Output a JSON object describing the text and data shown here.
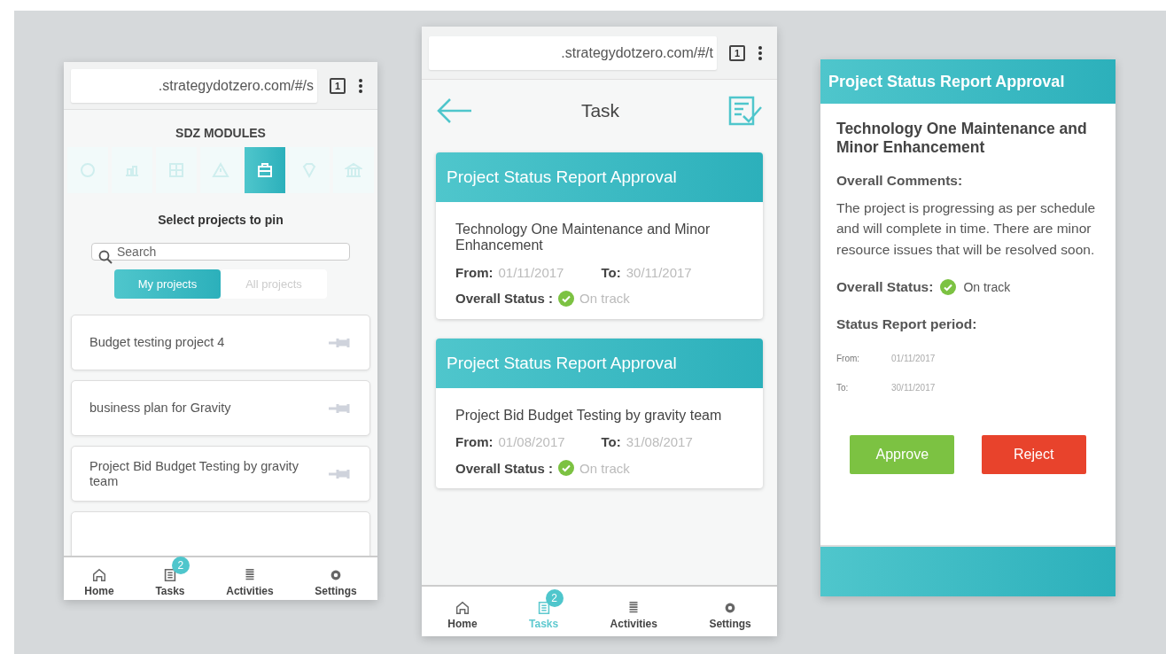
{
  "pin_screen": {
    "browser": {
      "url": ".strategydotzero.com/#/s",
      "tab_count": "1"
    },
    "modules_title": "SDZ MODULES",
    "modules": [
      {
        "selected": false
      },
      {
        "selected": false
      },
      {
        "selected": false
      },
      {
        "selected": false
      },
      {
        "selected": true
      },
      {
        "selected": false
      },
      {
        "selected": false
      }
    ],
    "heading": "Select projects to pin",
    "search": {
      "placeholder": "Search"
    },
    "tabs": [
      {
        "label": "My projects",
        "selected": true
      },
      {
        "label": "All projects",
        "selected": false
      }
    ],
    "projects": [
      "Budget testing project 4",
      "business plan for Gravity",
      "Project Bid Budget Testing by gravity team"
    ],
    "nav": [
      {
        "label": "Home",
        "selected": false
      },
      {
        "label": "Tasks",
        "selected": false,
        "badge": "2"
      },
      {
        "label": "Activities",
        "selected": false
      },
      {
        "label": "Settings",
        "selected": false
      }
    ]
  },
  "task_screen": {
    "browser": {
      "url": ".strategydotzero.com/#/t",
      "tab_count": "1"
    },
    "title": "Task",
    "cards": [
      {
        "header": "Project Status Report Approval",
        "project": "Technology One Maintenance and Minor Enhancement",
        "from_label": "From:",
        "from": "01/11/2017",
        "to_label": "To:",
        "to": "30/11/2017",
        "status_label": "Overall Status :",
        "status": "On track"
      },
      {
        "header": "Project Status Report Approval",
        "project": "Project Bid Budget Testing by gravity team",
        "from_label": "From:",
        "from": "01/08/2017",
        "to_label": "To:",
        "to": "31/08/2017",
        "status_label": "Overall Status :",
        "status": "On track"
      }
    ],
    "nav": [
      {
        "label": "Home",
        "selected": false
      },
      {
        "label": "Tasks",
        "selected": true,
        "badge": "2"
      },
      {
        "label": "Activities",
        "selected": false
      },
      {
        "label": "Settings",
        "selected": false
      }
    ]
  },
  "detail_screen": {
    "header": "Project Status Report Approval",
    "project": "Technology One Maintenance and Minor Enhancement",
    "comments_label": "Overall Comments:",
    "comments": "The project is progressing as per schedule and will complete in time. There are minor resource issues that will be resolved soon.",
    "status_label": "Overall Status:",
    "status": "On track",
    "period_label": "Status Report period:",
    "from_label": "From:",
    "from": "01/11/2017",
    "to_label": "To:",
    "to": "30/11/2017",
    "buttons": [
      {
        "kind": "approve",
        "label": "Approve"
      },
      {
        "kind": "reject",
        "label": "Reject"
      }
    ]
  }
}
